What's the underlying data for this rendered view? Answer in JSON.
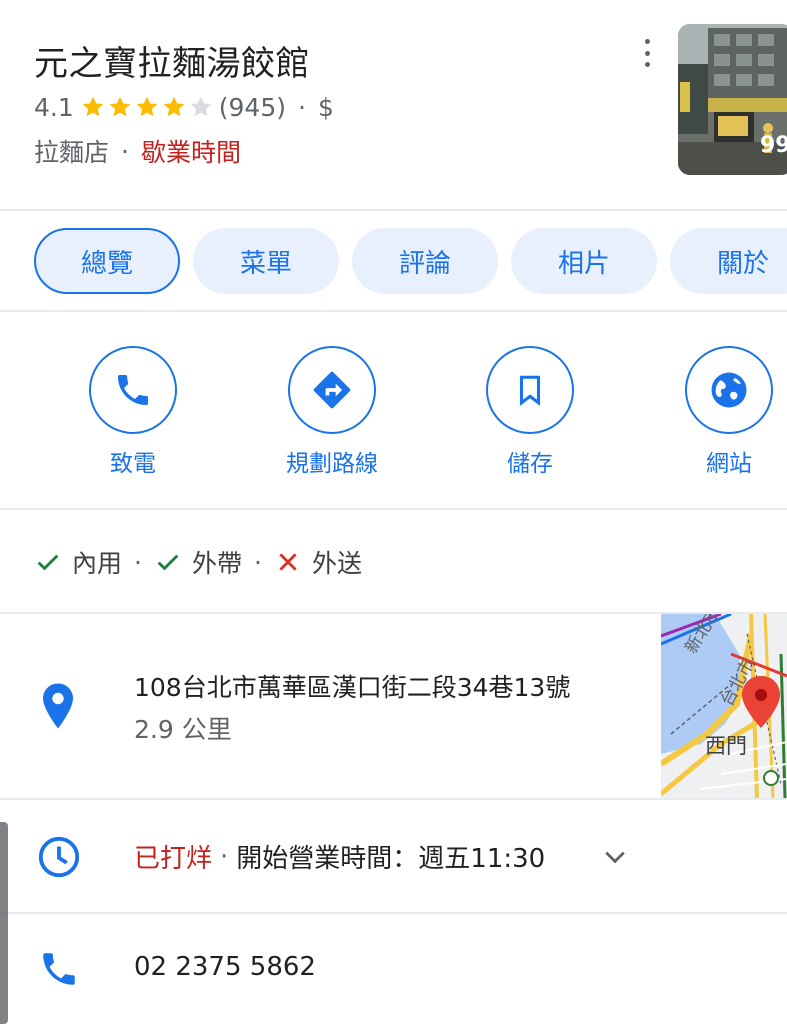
{
  "place": {
    "name": "元之寶拉麵湯餃館",
    "rating": "4.1",
    "stars_filled": 4,
    "stars_total": 5,
    "review_count": "(945)",
    "separator": "·",
    "price_level": "$",
    "category": "拉麵店",
    "hours_status": "歇業時間",
    "photo_count": "99"
  },
  "tabs": [
    {
      "label": "總覽",
      "active": true
    },
    {
      "label": "菜單",
      "active": false
    },
    {
      "label": "評論",
      "active": false
    },
    {
      "label": "相片",
      "active": false
    },
    {
      "label": "關於",
      "active": false
    }
  ],
  "actions": [
    {
      "label": "致電",
      "icon": "phone-icon"
    },
    {
      "label": "規劃路線",
      "icon": "directions-icon"
    },
    {
      "label": "儲存",
      "icon": "bookmark-icon"
    },
    {
      "label": "網站",
      "icon": "globe-icon"
    }
  ],
  "services": [
    {
      "label": "內用",
      "available": true
    },
    {
      "label": "外帶",
      "available": true
    },
    {
      "label": "外送",
      "available": false
    }
  ],
  "address": {
    "text": "108台北市萬華區漢口街二段34巷13號",
    "distance": "2.9 公里",
    "map_labels": {
      "area1": "新北市",
      "area2": "台北市",
      "station": "西門"
    }
  },
  "hours": {
    "status": "已打烊",
    "separator": "·",
    "next_open": "開始營業時間：週五11:30"
  },
  "phone": {
    "number": "02 2375 5862"
  },
  "colors": {
    "accent": "#1a73e8",
    "closed_red": "#c5221f",
    "star_gold": "#fbbc04",
    "check_green": "#188038",
    "chip_bg": "#e8f0fe"
  }
}
